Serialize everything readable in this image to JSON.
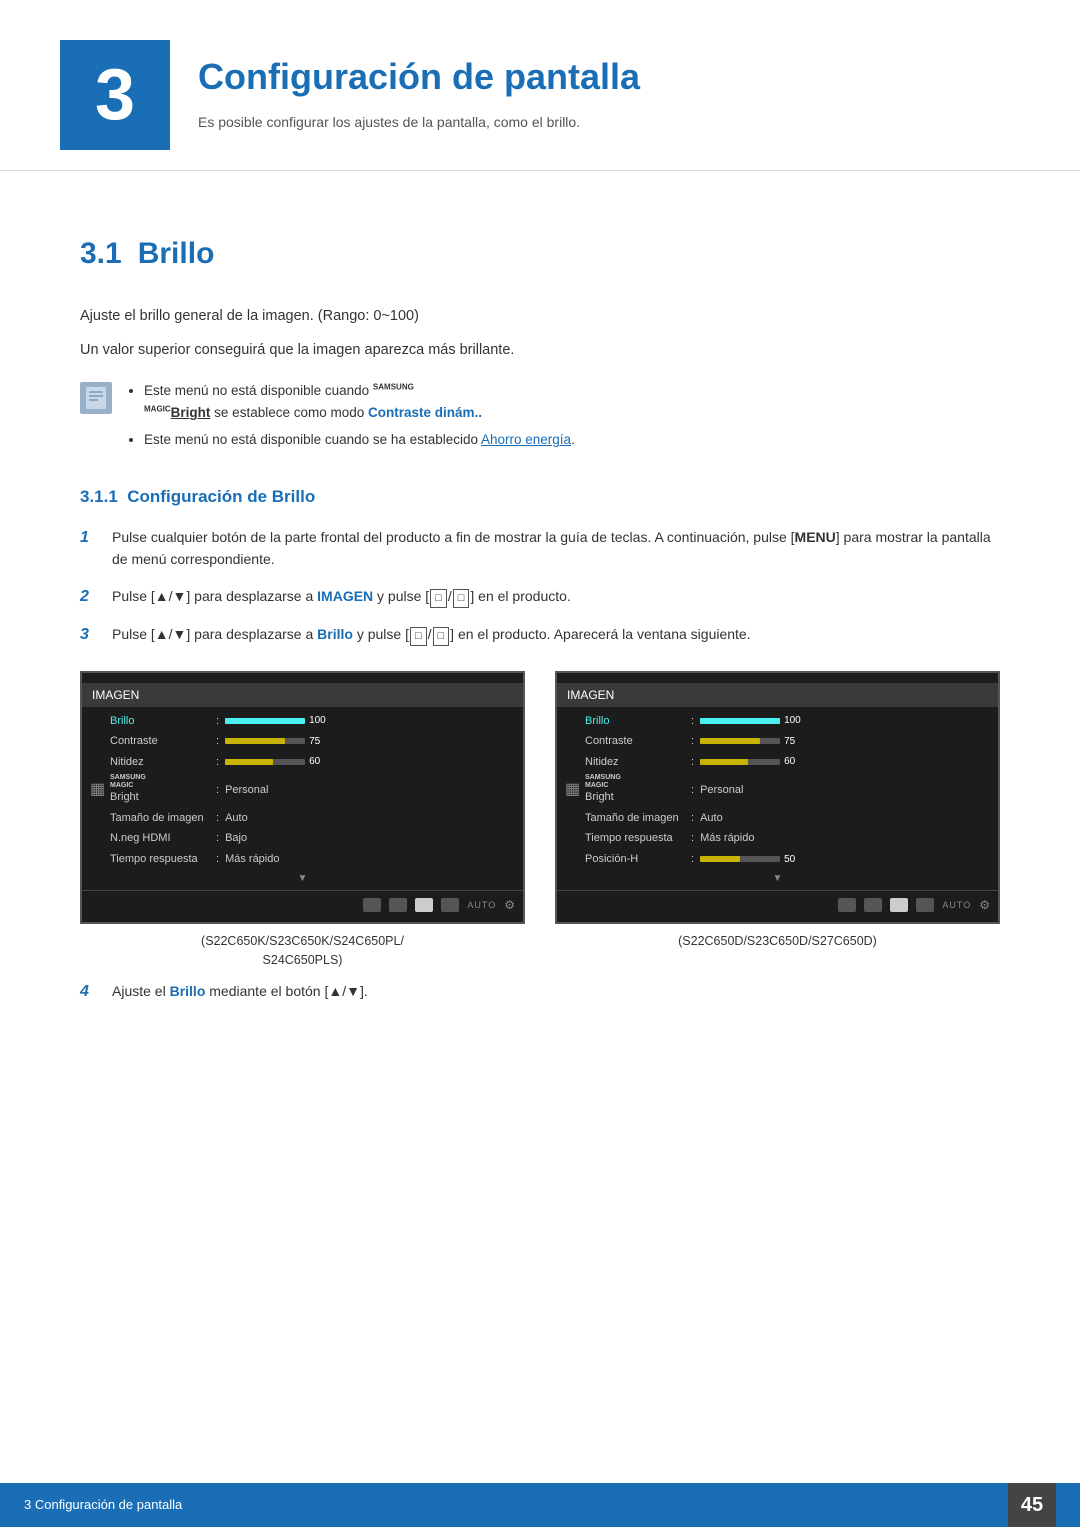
{
  "chapter": {
    "number": "3",
    "title": "Configuración de pantalla",
    "subtitle": "Es posible configurar los ajustes de la pantalla, como el brillo."
  },
  "section": {
    "number": "3.1",
    "title": "Brillo",
    "descriptions": [
      "Ajuste el brillo general de la imagen. (Rango: 0~100)",
      "Un valor superior conseguirá que la imagen aparezca más brillante."
    ],
    "notes": [
      {
        "text_parts": [
          {
            "type": "plain",
            "text": "Este menú no está disponible cuando "
          },
          {
            "type": "samsung-magic",
            "text": "SAMSUNG\nMAGIC"
          },
          {
            "type": "bold-underline",
            "text": "Bright"
          },
          {
            "type": "plain",
            "text": " se establece como modo "
          },
          {
            "type": "bold-blue",
            "text": "Contraste dinám.."
          }
        ]
      },
      {
        "text_parts": [
          {
            "type": "plain",
            "text": "Este menú no está disponible cuando se ha establecido "
          },
          {
            "type": "link",
            "text": "Ahorro energía"
          },
          {
            "type": "plain",
            "text": "."
          }
        ]
      }
    ]
  },
  "subsection": {
    "number": "3.1.1",
    "title": "Configuración de Brillo"
  },
  "steps": [
    {
      "number": "1",
      "text": "Pulse cualquier botón de la parte frontal del producto a fin de mostrar la guía de teclas. A continuación, pulse [MENU] para mostrar la pantalla de menú correspondiente."
    },
    {
      "number": "2",
      "text": "Pulse [▲/▼] para desplazarse a IMAGEN y pulse [□/□] en el producto."
    },
    {
      "number": "3",
      "text": "Pulse [▲/▼] para desplazarse a Brillo y pulse [□/□] en el producto. Aparecerá la ventana siguiente."
    },
    {
      "number": "4",
      "text": "Ajuste el Brillo mediante el botón [▲/▼]."
    }
  ],
  "screenshots": [
    {
      "title": "IMAGEN",
      "rows": [
        {
          "label": "Brillo",
          "type": "bar",
          "fill": 100,
          "value": "100",
          "active": true
        },
        {
          "label": "Contraste",
          "type": "bar",
          "fill": 75,
          "value": "75",
          "active": false
        },
        {
          "label": "Nitidez",
          "type": "bar",
          "fill": 60,
          "value": "60",
          "active": false
        },
        {
          "label": "MAGIC Bright",
          "type": "text",
          "value": "Personal",
          "active": false
        },
        {
          "label": "Tamaño de imagen",
          "type": "text",
          "value": "Auto",
          "active": false
        },
        {
          "label": "N.neg HDMI",
          "type": "text",
          "value": "Bajo",
          "active": false
        },
        {
          "label": "Tiempo respuesta",
          "type": "text",
          "value": "Más rápido",
          "active": false
        }
      ],
      "caption": "(S22C650K/S23C650K/S24C650PL/\nS24C650PLS)"
    },
    {
      "title": "IMAGEN",
      "rows": [
        {
          "label": "Brillo",
          "type": "bar",
          "fill": 100,
          "value": "100",
          "active": true
        },
        {
          "label": "Contraste",
          "type": "bar",
          "fill": 75,
          "value": "75",
          "active": false
        },
        {
          "label": "Nitidez",
          "type": "bar",
          "fill": 60,
          "value": "60",
          "active": false
        },
        {
          "label": "MAGIC Bright",
          "type": "text",
          "value": "Personal",
          "active": false
        },
        {
          "label": "Tamaño de imagen",
          "type": "text",
          "value": "Auto",
          "active": false
        },
        {
          "label": "Tiempo respuesta",
          "type": "text",
          "value": "Más rápido",
          "active": false
        },
        {
          "label": "Posición-H",
          "type": "bar",
          "fill": 50,
          "value": "50",
          "active": false
        }
      ],
      "caption": "(S22C650D/S23C650D/S27C650D)"
    }
  ],
  "footer": {
    "section_label": "3 Configuración de pantalla",
    "page_number": "45"
  }
}
